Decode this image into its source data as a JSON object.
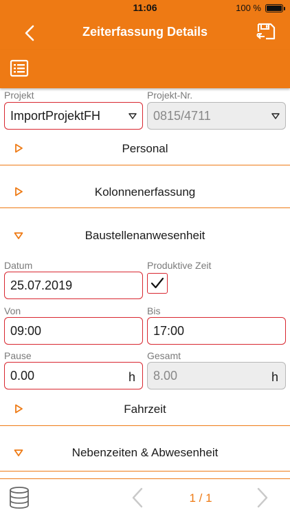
{
  "status": {
    "time": "11:06",
    "battery": "100 %"
  },
  "nav": {
    "title": "Zeiterfassung Details"
  },
  "projekt": {
    "label": "Projekt",
    "value": "ImportProjektFH"
  },
  "projekt_nr": {
    "label": "Projekt-Nr.",
    "value": "0815/4711"
  },
  "sections": {
    "personal": "Personal",
    "kolonne": "Kolonnenerfassung",
    "baustelle": "Baustellenanwesenheit",
    "fahrzeit": "Fahrzeit",
    "nebenzeiten": "Nebenzeiten & Abwesenheit"
  },
  "datum": {
    "label": "Datum",
    "value": "25.07.2019"
  },
  "produktiv": {
    "label": "Produktive Zeit",
    "checked": true
  },
  "von": {
    "label": "Von",
    "value": "09:00"
  },
  "bis": {
    "label": "Bis",
    "value": "17:00"
  },
  "pause": {
    "label": "Pause",
    "value": "0.00",
    "unit": "h"
  },
  "gesamt": {
    "label": "Gesamt",
    "value": "8.00",
    "unit": "h"
  },
  "pager": {
    "text": "1 / 1"
  },
  "colors": {
    "accent": "#ee7a14",
    "error": "#d8262f"
  }
}
